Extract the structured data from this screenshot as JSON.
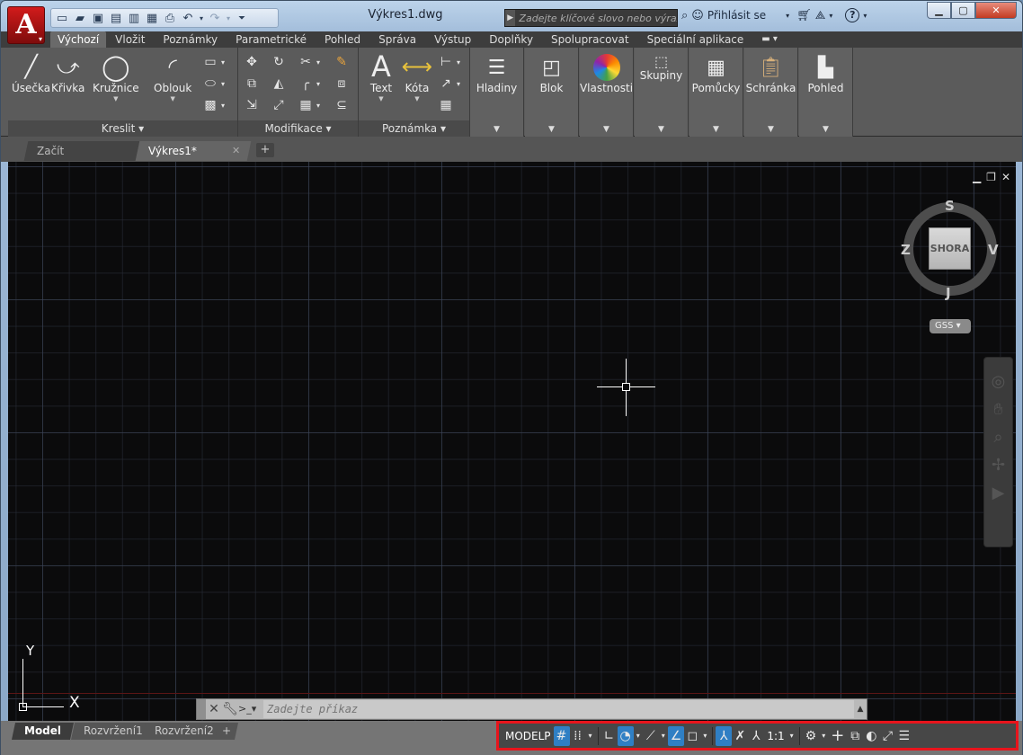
{
  "window": {
    "title": "Výkres1.dwg"
  },
  "app_button": {
    "letter": "A"
  },
  "search": {
    "placeholder": "Zadejte klíčové slovo nebo výraz."
  },
  "user": {
    "signin": "Přihlásit se"
  },
  "ribbon_tabs": [
    "Výchozí",
    "Vložit",
    "Poznámky",
    "Parametrické",
    "Pohled",
    "Správa",
    "Výstup",
    "Doplňky",
    "Spolupracovat",
    "Speciální aplikace"
  ],
  "active_tab": "Výchozí",
  "panels": {
    "kreslit": {
      "title": "Kreslit",
      "line": "Úsečka",
      "polyline": "Křivka",
      "circle": "Kružnice",
      "arc": "Oblouk"
    },
    "modifikace": {
      "title": "Modifikace"
    },
    "poznamka": {
      "title": "Poznámka",
      "text": "Text",
      "dim": "Kóta"
    },
    "tiles": [
      "Hladiny",
      "Blok",
      "Vlastnosti",
      "Skupiny",
      "Pomůcky",
      "Schránka",
      "Pohled"
    ]
  },
  "doc_tabs": {
    "start": "Začít",
    "drawing": "Výkres1*"
  },
  "viewcube": {
    "face": "SHORA",
    "north": "S",
    "south": "J",
    "east": "V",
    "west": "Z",
    "ucs_menu": "GSS"
  },
  "ucs": {
    "x": "X",
    "y": "Y"
  },
  "command": {
    "placeholder": "Zadejte příkaz"
  },
  "layout_tabs": [
    "Model",
    "Rozvržení1",
    "Rozvržení2"
  ],
  "status": {
    "space": "MODELP",
    "scale": "1:1"
  },
  "colors": {
    "accent_blue": "#2f7fc4",
    "highlight_red": "#e8141c",
    "canvas": "#0b0b0c"
  }
}
